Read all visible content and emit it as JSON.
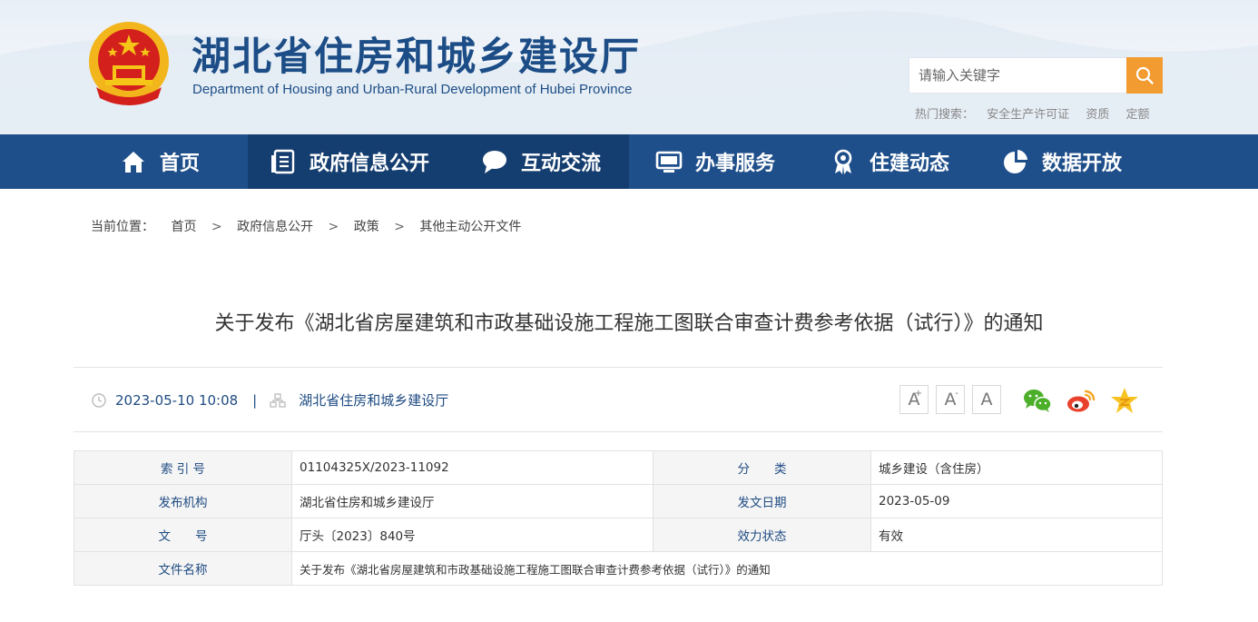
{
  "header": {
    "title": "湖北省住房和城乡建设厅",
    "subtitle": "Department of Housing and Urban-Rural Development of Hubei Province",
    "search_placeholder": "请输入关键字",
    "hot_label": "热门搜索：",
    "hot_terms": [
      "安全生产许可证",
      "资质",
      "定额"
    ]
  },
  "nav": {
    "items": [
      {
        "label": "首页",
        "icon": "home-icon"
      },
      {
        "label": "政府信息公开",
        "icon": "document-list-icon"
      },
      {
        "label": "互动交流",
        "icon": "chat-bubble-icon"
      },
      {
        "label": "办事服务",
        "icon": "monitor-icon"
      },
      {
        "label": "住建动态",
        "icon": "award-icon"
      },
      {
        "label": "数据开放",
        "icon": "pie-chart-icon"
      }
    ],
    "active_index": 1
  },
  "breadcrumb": {
    "label": "当前位置：",
    "items": [
      "首页",
      "政府信息公开",
      "政策",
      "其他主动公开文件"
    ],
    "separator": ">"
  },
  "article": {
    "title": "关于发布《湖北省房屋建筑和市政基础设施工程施工图联合审查计费参考依据（试行）》的通知",
    "datetime": "2023-05-10 10:08",
    "separator": "|",
    "source": "湖北省住房和城乡建设厅"
  },
  "font_size_buttons": [
    "A",
    "A",
    "A"
  ],
  "font_size_plus": "+",
  "font_size_minus": "-",
  "share_icons": [
    "wechat-icon",
    "weibo-icon",
    "qzone-icon"
  ],
  "info_table": {
    "index_label": "索 引 号",
    "index_value": "01104325X/2023-11092",
    "category_label": "分　　类",
    "category_value": "城乡建设（含住房）",
    "publisher_label": "发布机构",
    "publisher_value": "湖北省住房和城乡建设厅",
    "date_label": "发文日期",
    "date_value": "2023-05-09",
    "docno_label": "文　　号",
    "docno_value": "厅头〔2023〕840号",
    "status_label": "效力状态",
    "status_value": "有效",
    "filename_label": "文件名称",
    "filename_value": "关于发布《湖北省房屋建筑和市政基础设施工程施工图联合审查计费参考依据（试行）》的通知"
  },
  "colors": {
    "nav_bg": "#1f4f8a",
    "nav_active": "#153e70",
    "brand_blue": "#1c4d86",
    "search_orange": "#f29b30"
  }
}
